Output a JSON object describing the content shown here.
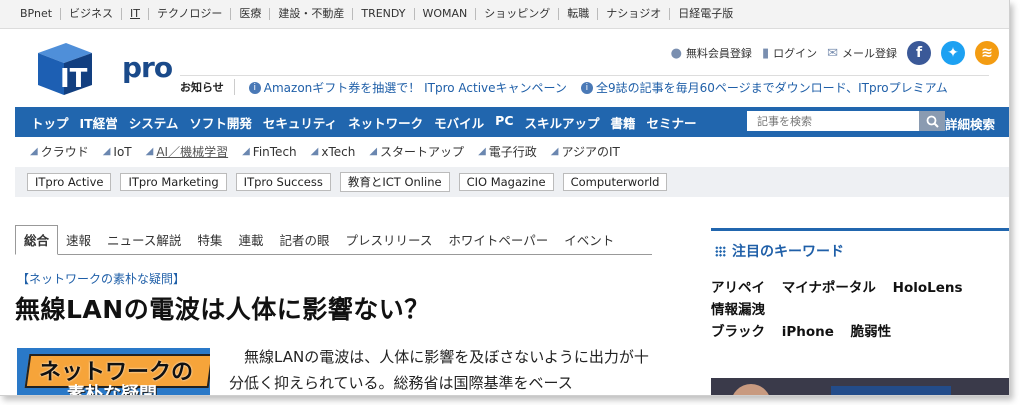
{
  "network_bar": [
    "BPnet",
    "ビジネス",
    "IT",
    "テクノロジー",
    "医療",
    "建設・不動産",
    "TRENDY",
    "WOMAN",
    "ショッピング",
    "転職",
    "ナショジオ",
    "日経電子版"
  ],
  "logo": {
    "text": "pro",
    "letter": "IT"
  },
  "header_links": {
    "signup": "無料会員登録",
    "login": "ログイン",
    "mail": "メール登録"
  },
  "notice": {
    "label": "お知らせ",
    "items": [
      "Amazonギフト券を抽選で！ ITpro Activeキャンペーン",
      "全9誌の記事を毎月60ページまでダウンロード、ITproプレミアム"
    ]
  },
  "main_nav": [
    "トップ",
    "IT経営",
    "システム",
    "ソフト開発",
    "セキュリティ",
    "ネットワーク",
    "モバイル",
    "PC",
    "スキルアップ",
    "書籍",
    "セミナー"
  ],
  "search": {
    "placeholder": "記事を検索",
    "advanced": "詳細検索"
  },
  "tags": [
    "クラウド",
    "IoT",
    "AI／機械学習",
    "FinTech",
    "xTech",
    "スタートアップ",
    "電子行政",
    "アジアのIT"
  ],
  "sites": [
    "ITpro Active",
    "ITpro Marketing",
    "ITpro Success",
    "教育とICT Online",
    "CIO Magazine",
    "Computerworld"
  ],
  "article_tabs": [
    "総合",
    "速報",
    "ニュース解説",
    "特集",
    "連載",
    "記者の眼",
    "プレスリリース",
    "ホワイトペーパー",
    "イベント"
  ],
  "article": {
    "category": "【ネットワークの素朴な疑問】",
    "title": "無線LANの電波は人体に影響ない？",
    "thumb_line1": "ネットワークの",
    "thumb_line2": "素朴な疑問",
    "body": "無線LANの電波は、人体に影響を及ぼさないように出力が十分低く抑えられている。総務省は国際基準をベース"
  },
  "sidebar": {
    "title": "注目のキーワード",
    "keywords": [
      "アリペイ",
      "マイナポータル",
      "HoloLens",
      "情報漏洩",
      "ブラック",
      "iPhone",
      "脆弱性"
    ]
  },
  "colors": {
    "nav_blue": "#2166ae",
    "link_blue": "#1f5fa8"
  }
}
